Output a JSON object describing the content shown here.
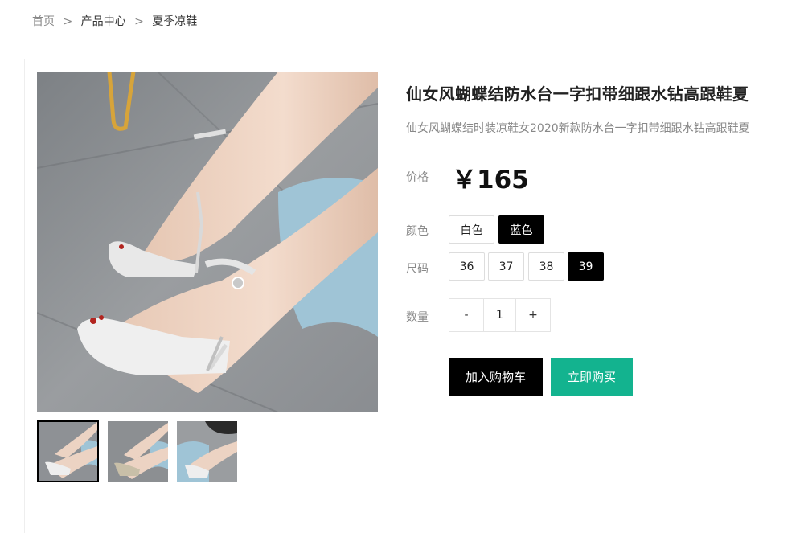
{
  "breadcrumb": {
    "home": "首页",
    "separator": ">",
    "category": "产品中心",
    "current": "夏季凉鞋"
  },
  "product": {
    "title": "仙女风蝴蝶结防水台一字扣带细跟水钻高跟鞋夏",
    "subtitle": "仙女风蝴蝶结时装凉鞋女2020新款防水台一字扣带细跟水钻高跟鞋夏",
    "price_label": "价格",
    "price": "￥165",
    "color_label": "颜色",
    "colors": [
      {
        "label": "白色",
        "selected": false
      },
      {
        "label": "蓝色",
        "selected": true
      }
    ],
    "size_label": "尺码",
    "sizes": [
      {
        "label": "36",
        "selected": false
      },
      {
        "label": "37",
        "selected": false
      },
      {
        "label": "38",
        "selected": false
      },
      {
        "label": "39",
        "selected": true
      }
    ],
    "quantity_label": "数量",
    "quantity": {
      "decrement": "-",
      "value": "1",
      "increment": "+"
    }
  },
  "actions": {
    "add_to_cart": "加入购物车",
    "buy_now": "立即购买"
  },
  "colors": {
    "accent_green": "#13b38f",
    "selected_black": "#000000"
  },
  "images": {
    "main": "sandal-photo",
    "thumbnails": [
      "sandal-photo-1",
      "sandal-photo-2",
      "sandal-photo-3"
    ]
  }
}
